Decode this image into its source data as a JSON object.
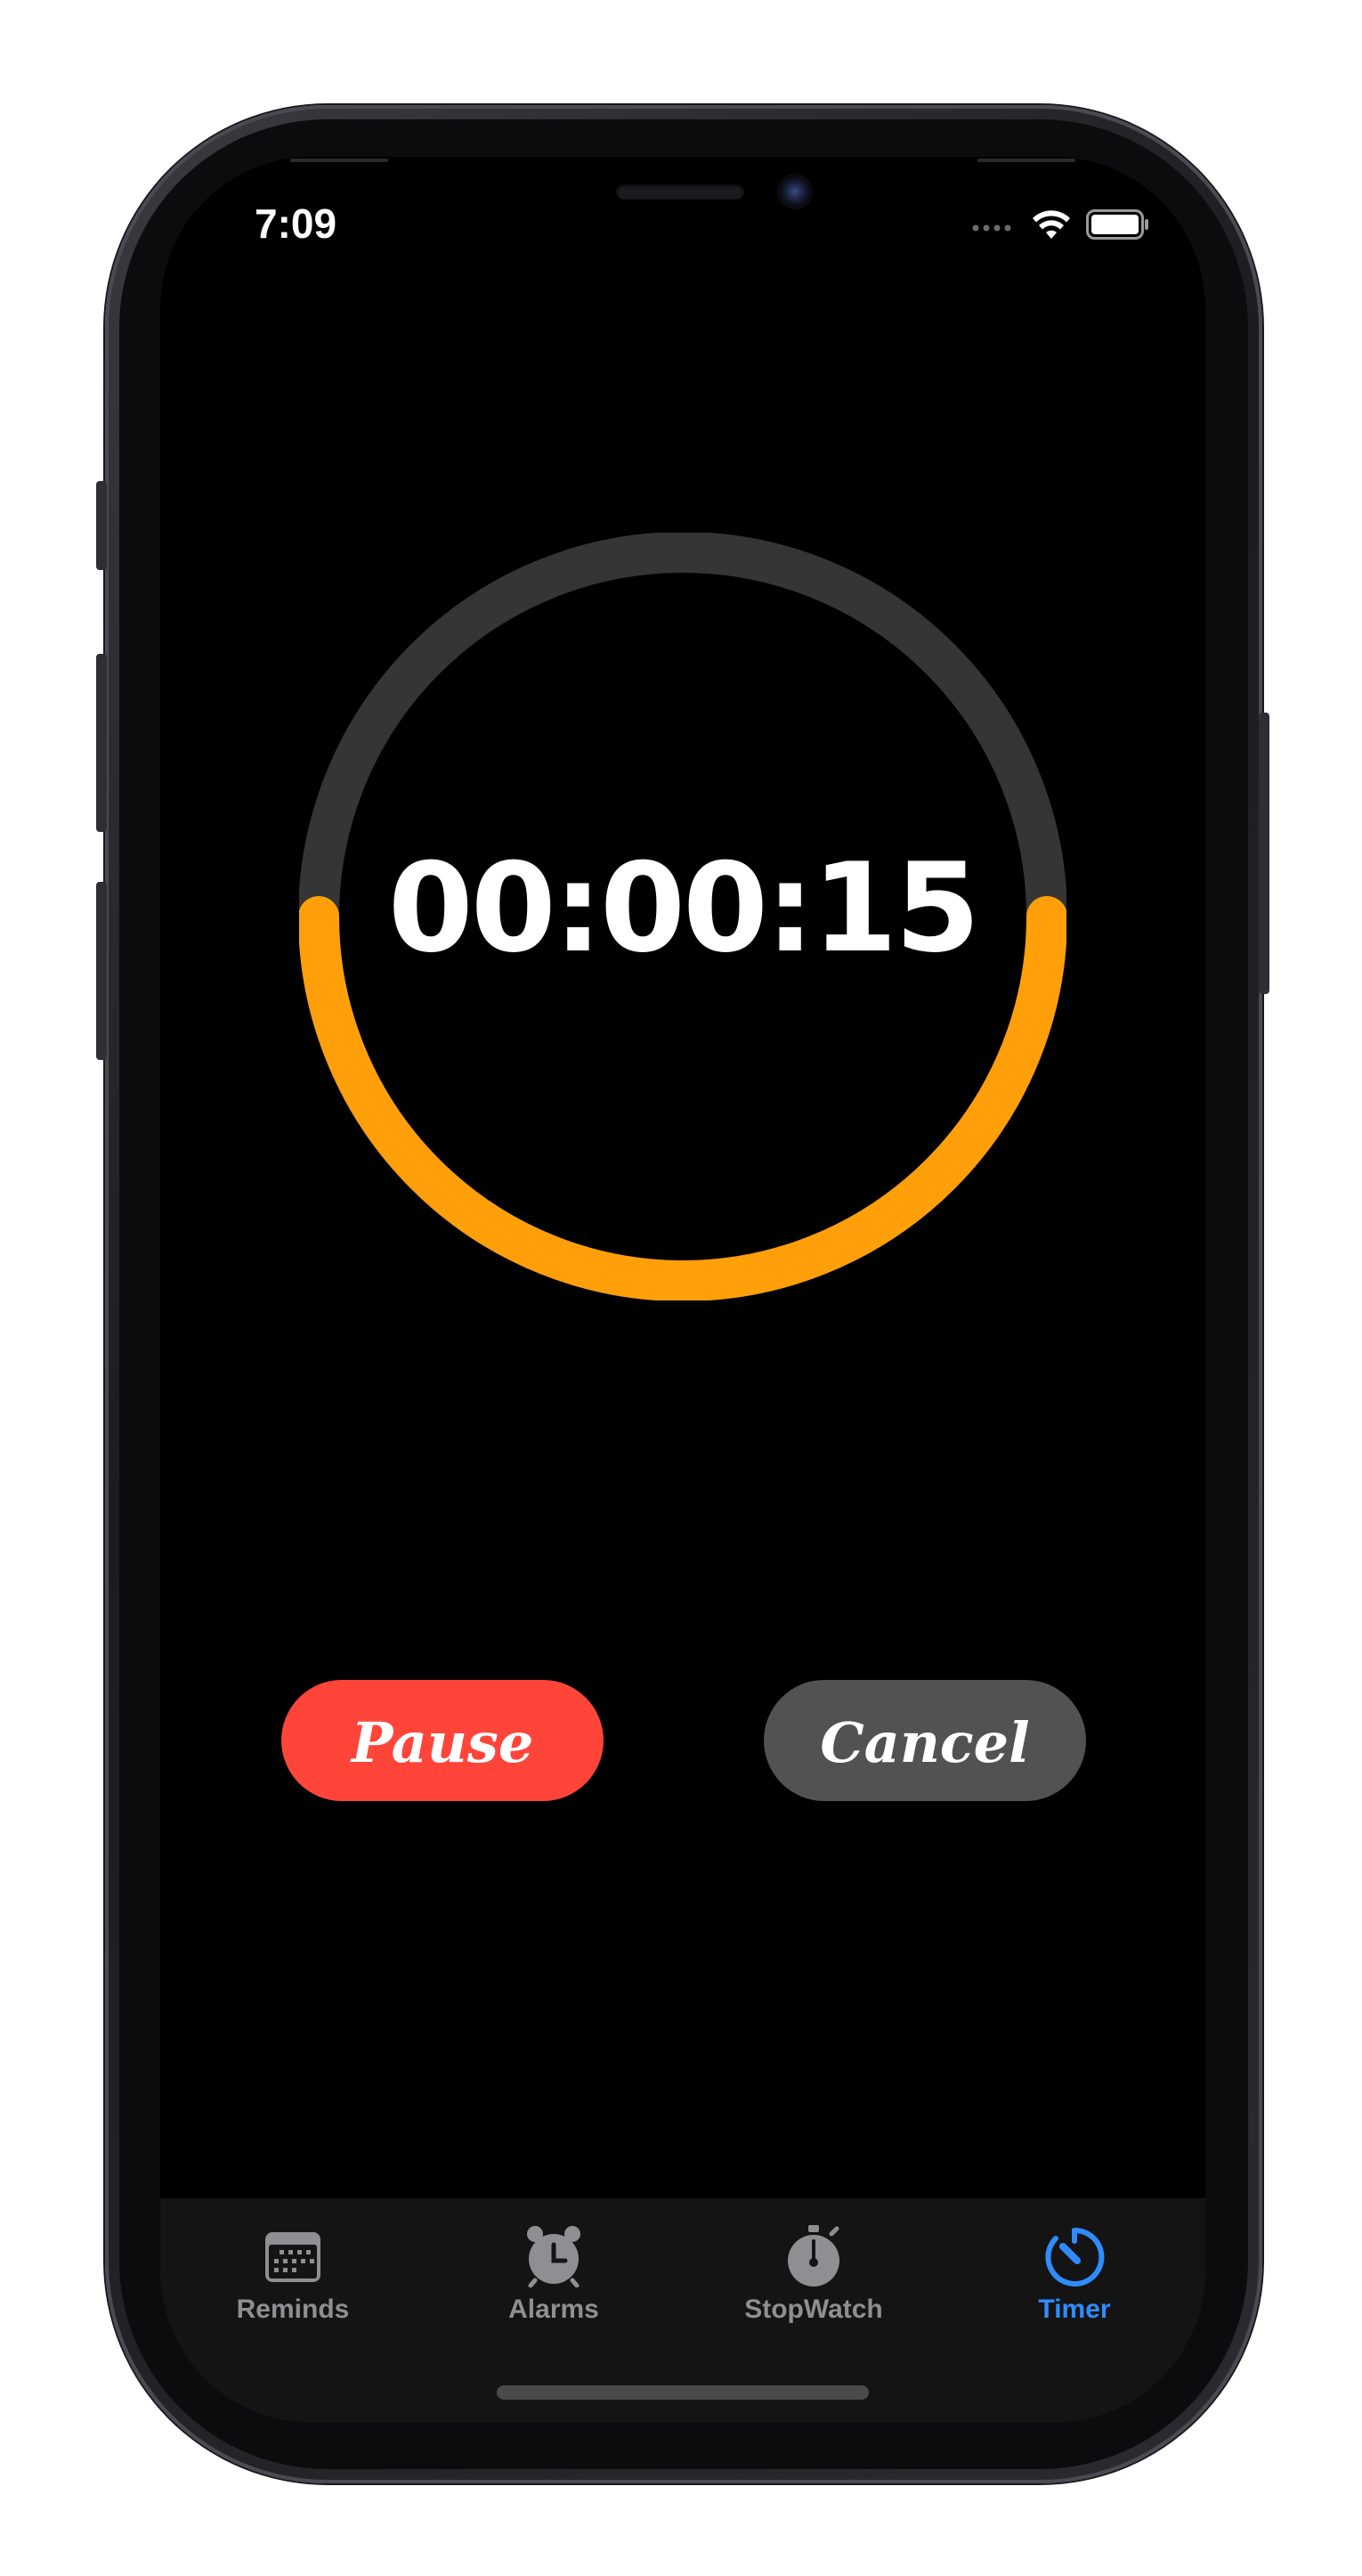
{
  "status_bar": {
    "time": "7:09",
    "icons": [
      "cellular-signal-icon",
      "wifi-icon",
      "battery-icon"
    ]
  },
  "timer": {
    "display": "00:00:15",
    "progress_remaining_fraction": 0.5,
    "track_color": "#353535",
    "progress_color": "#ff9f0a"
  },
  "controls": {
    "pause_label": "Pause",
    "cancel_label": "Cancel",
    "pause_color": "#ff453a",
    "cancel_color": "#525252"
  },
  "tab_bar": {
    "selected": "Timer",
    "active_color": "#2f8cff",
    "inactive_color": "#8e8e93",
    "items": [
      {
        "label": "Reminds",
        "icon": "calendar-icon"
      },
      {
        "label": "Alarms",
        "icon": "alarm-clock-icon"
      },
      {
        "label": "StopWatch",
        "icon": "stopwatch-icon"
      },
      {
        "label": "Timer",
        "icon": "timer-icon"
      }
    ]
  }
}
